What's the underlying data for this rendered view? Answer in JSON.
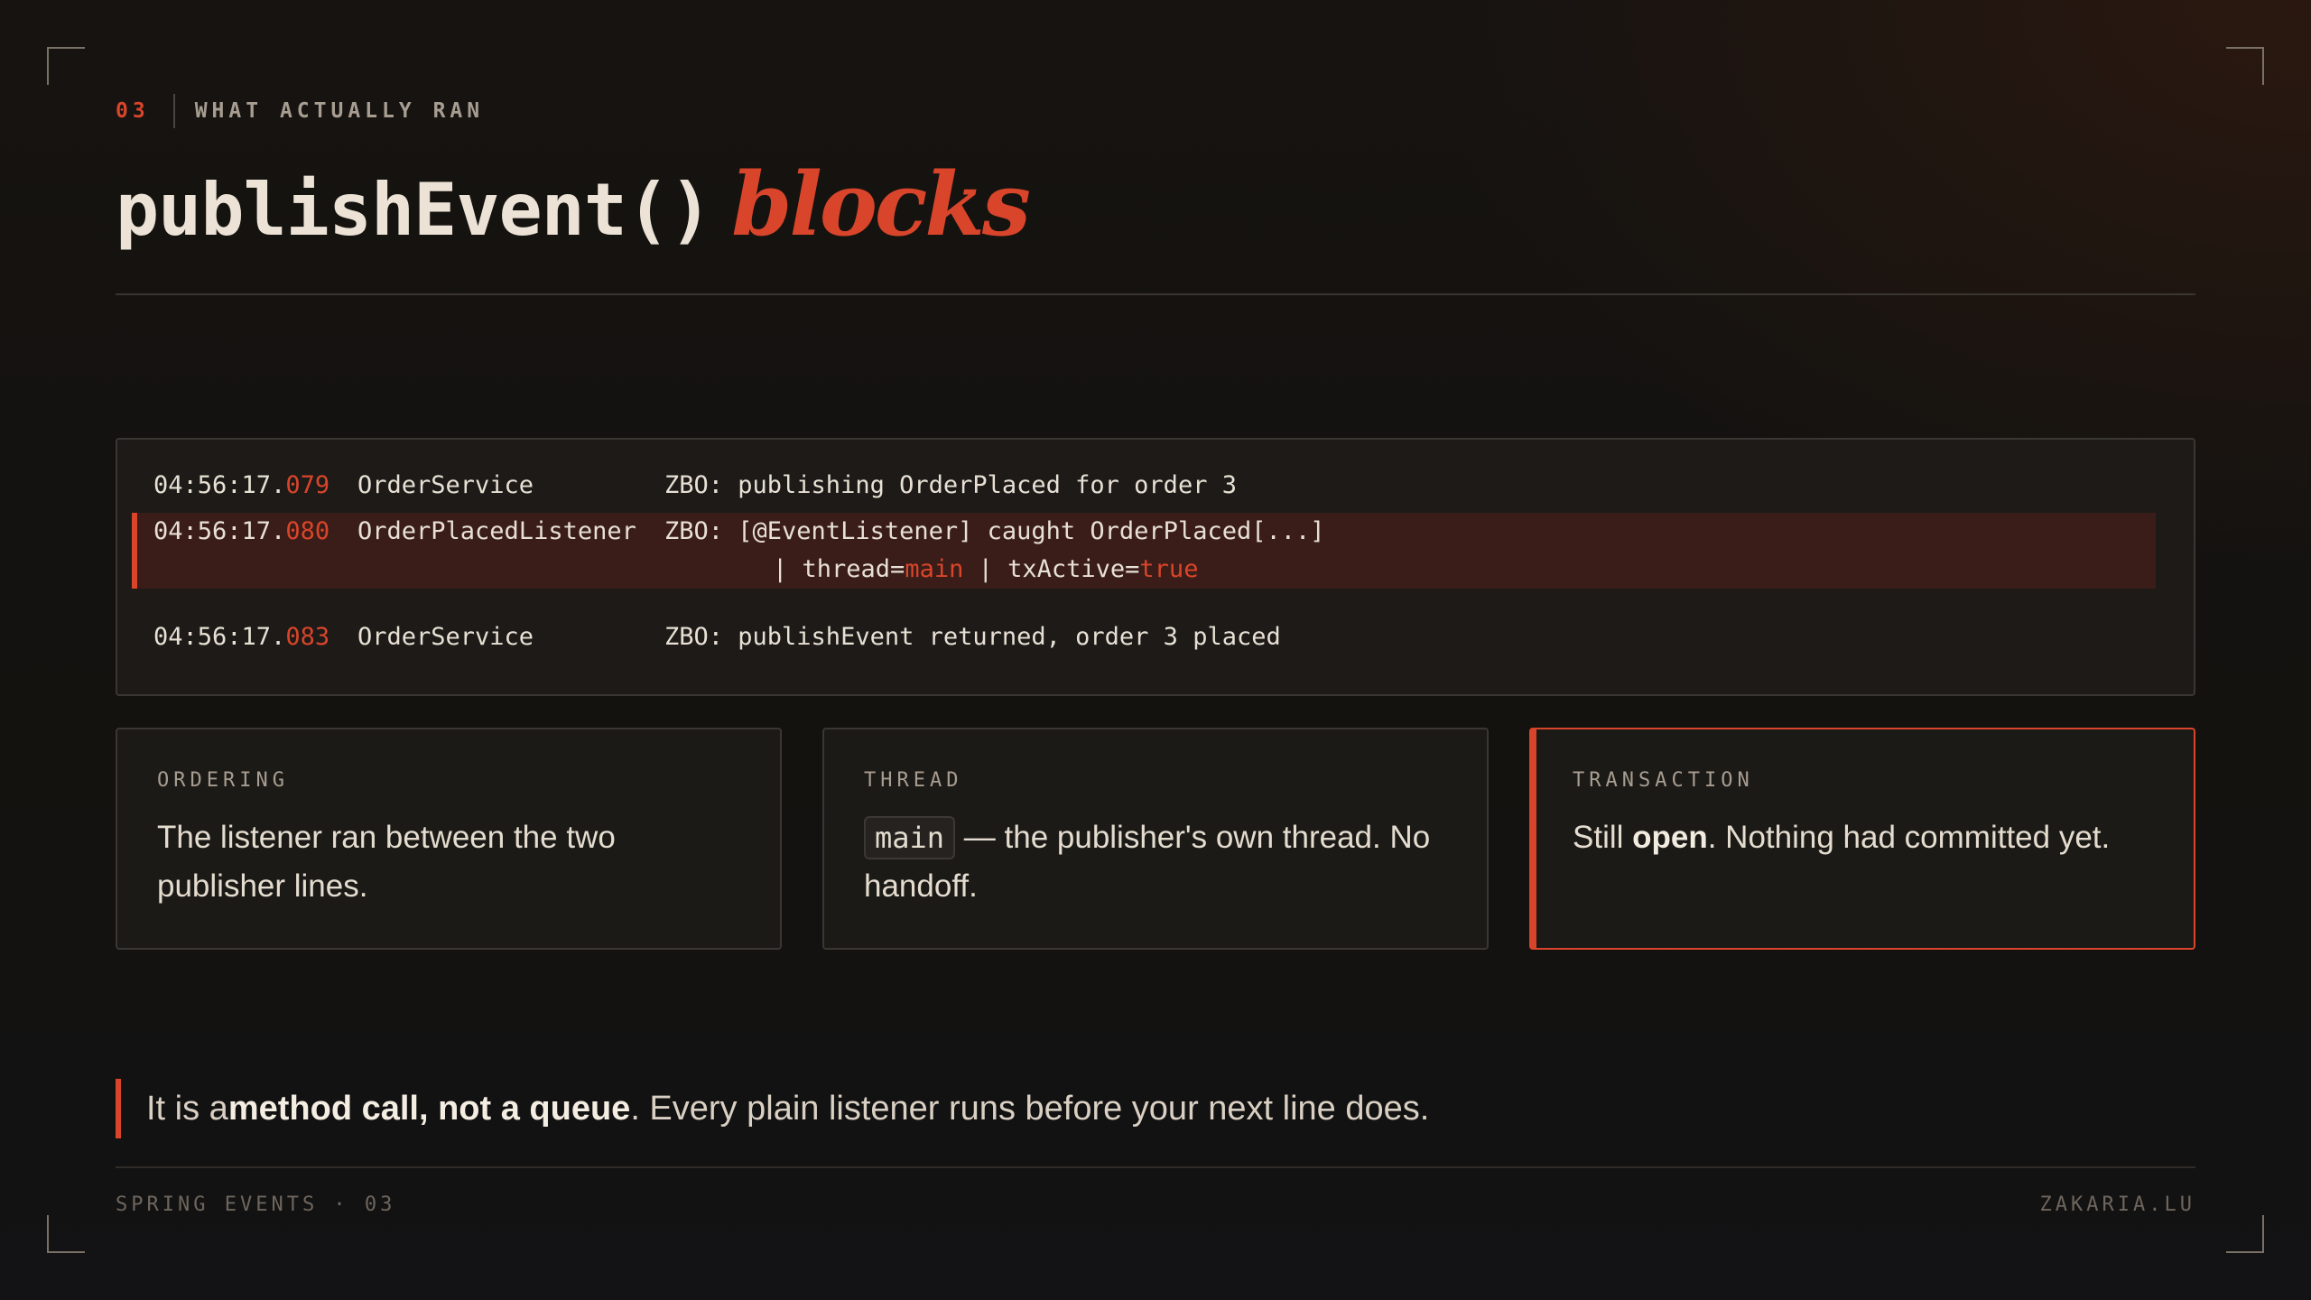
{
  "kicker": {
    "number": "03",
    "label": "WHAT ACTUALLY RAN"
  },
  "title": {
    "code": "publishEvent()",
    "emphasis": "blocks"
  },
  "log": {
    "lines": [
      {
        "ts_prefix": "04:56:17.",
        "ts_ms": "079",
        "source": "OrderService",
        "message": "ZBO: publishing OrderPlaced for order 3"
      },
      {
        "ts_prefix": "04:56:17.",
        "ts_ms": "080",
        "source": "OrderPlacedListener",
        "message": "ZBO: [@EventListener] caught OrderPlaced[...]"
      },
      {
        "ts_prefix": "04:56:17.",
        "ts_ms": "083",
        "source": "OrderService",
        "message": "ZBO: publishEvent returned, order 3 placed"
      }
    ],
    "continuation": {
      "p1": "| thread=",
      "thread": "main",
      "p2": " | txActive=",
      "tx": "true"
    }
  },
  "cards": {
    "ordering": {
      "caption": "ORDERING",
      "text": "The listener ran between the two publisher lines."
    },
    "thread": {
      "caption": "THREAD",
      "chip": "main",
      "text": " — the publisher's own thread. No handoff."
    },
    "transaction": {
      "caption": "TRANSACTION",
      "pre": "Still ",
      "bold": "open",
      "post": ". Nothing had committed yet."
    }
  },
  "quote": {
    "pre": "It is a ",
    "bold": "method call, not a queue",
    "post": ". Every plain listener runs before your next line does."
  },
  "footer": {
    "left": "SPRING EVENTS · 03",
    "right": "ZAKARIA.LU"
  },
  "colors": {
    "accent": "#d8452a",
    "background": "#161311",
    "text": "#ece3d6"
  }
}
